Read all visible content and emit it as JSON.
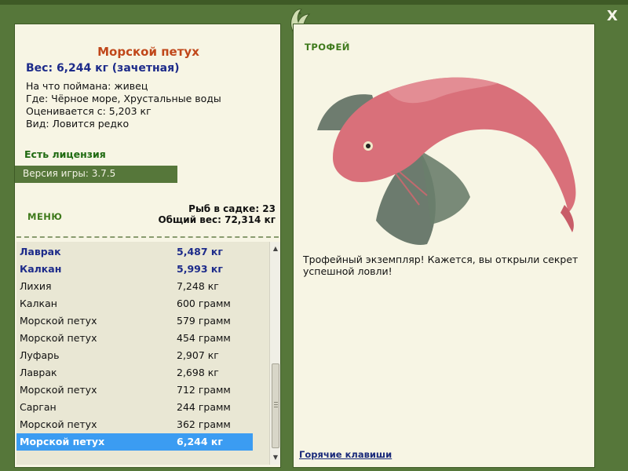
{
  "window": {
    "close_label": "X"
  },
  "fish": {
    "name": "Морской петух",
    "weight_line": "Вес: 6,244 кг (зачетная)",
    "info": [
      "На что поймана: живец",
      "Где: Чёрное море, Хрустальные воды",
      "Оценивается с: 5,203 кг",
      "Вид: Ловится редко"
    ]
  },
  "license": "Есть лицензия",
  "version": "Версия игры: 3.7.5",
  "menu_label": "МЕНЮ",
  "stats": {
    "count_line": "Рыб в садке: 23",
    "total_line": "Общий вес: 72,314 кг"
  },
  "catch_list": [
    {
      "name": "Лаврак",
      "weight": "5,487 кг",
      "style": "bold"
    },
    {
      "name": "Калкан",
      "weight": "5,993 кг",
      "style": "bold"
    },
    {
      "name": "Лихия",
      "weight": "7,248 кг",
      "style": "normal"
    },
    {
      "name": "Калкан",
      "weight": "600 грамм",
      "style": "normal"
    },
    {
      "name": "Морской петух",
      "weight": "579 грамм",
      "style": "normal"
    },
    {
      "name": "Морской петух",
      "weight": "454 грамм",
      "style": "normal"
    },
    {
      "name": "Луфарь",
      "weight": "2,907 кг",
      "style": "normal"
    },
    {
      "name": "Лаврак",
      "weight": "2,698 кг",
      "style": "normal"
    },
    {
      "name": "Морской петух",
      "weight": "712 грамм",
      "style": "normal"
    },
    {
      "name": "Сарган",
      "weight": "244 грамм",
      "style": "normal"
    },
    {
      "name": "Морской петух",
      "weight": "362 грамм",
      "style": "normal"
    },
    {
      "name": "Морской петух",
      "weight": "6,244 кг",
      "style": "selected"
    }
  ],
  "trophy": {
    "label": "ТРОФЕЙ",
    "text": "Трофейный экземпляр! Кажется, вы открыли секрет успешной ловли!"
  },
  "hotkeys": "Горячие клавиши",
  "colors": {
    "frame": "#56773a",
    "panel": "#f7f5e4",
    "title": "#c0471a",
    "accent_blue": "#1d2b8a",
    "selection": "#3b9cf2"
  }
}
